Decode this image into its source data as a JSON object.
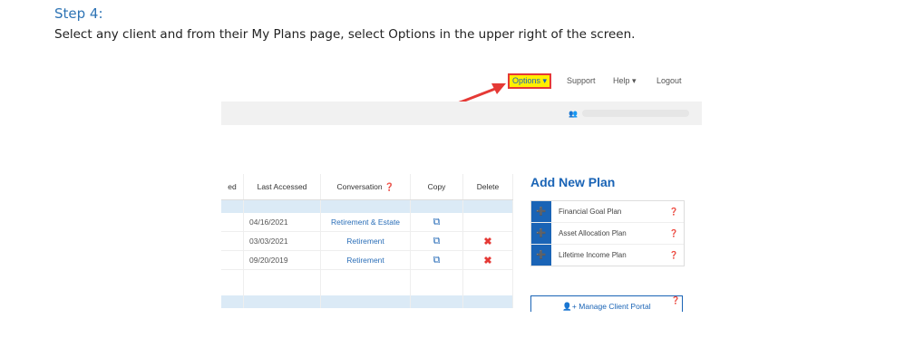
{
  "step": {
    "title": "Step 4:",
    "description": "Select any client and from their My Plans page, select Options in the upper right of the screen."
  },
  "nav": {
    "options": "Options ▾",
    "support": "Support",
    "help": "Help ▾",
    "logout": "Logout"
  },
  "table": {
    "headers": [
      "ed",
      "Last Accessed",
      "Conversation",
      "Copy",
      "Delete"
    ],
    "rows": [
      {
        "date": "04/16/2021",
        "conversation": "Retirement & Estate",
        "deletable": false
      },
      {
        "date": "03/03/2021",
        "conversation": "Retirement",
        "deletable": true
      },
      {
        "date": "09/20/2019",
        "conversation": "Retirement",
        "deletable": true
      }
    ]
  },
  "add_plan": {
    "title": "Add New Plan",
    "items": [
      "Financial Goal Plan",
      "Asset Allocation Plan",
      "Lifetime Income Plan"
    ],
    "portal_label": "Manage Client Portal"
  },
  "icons": {
    "plus": "plus-circle-icon",
    "help": "question-circle-icon",
    "copy": "copy-icon",
    "delete": "x-icon"
  },
  "colors": {
    "accent": "#1a64b6",
    "highlight": "#ffef00",
    "arrow": "#e53935"
  }
}
